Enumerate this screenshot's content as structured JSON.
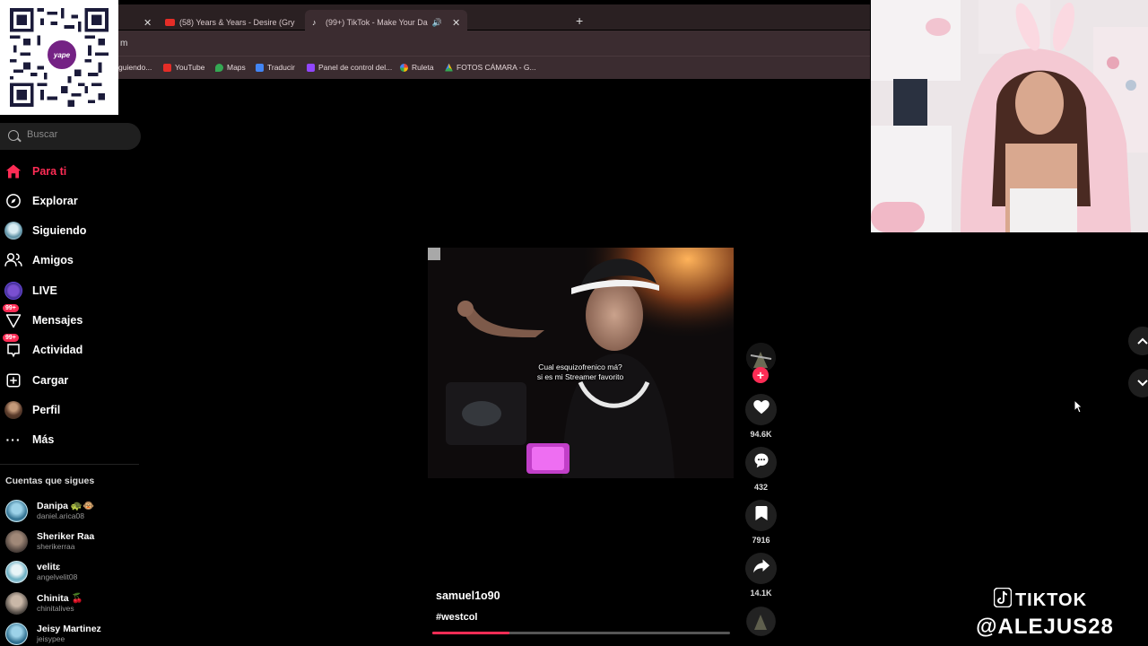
{
  "browser": {
    "tabs": [
      {
        "label": "(58) Years & Years - Desire (Gry",
        "icon": "youtube-icon"
      },
      {
        "label": "(99+) TikTok - Make Your Da",
        "icon": "tiktok-icon",
        "active": true
      }
    ],
    "address_fragment": "m",
    "bookmarks": [
      {
        "label": "guiendo..."
      },
      {
        "label": "YouTube",
        "color": "#e52d27"
      },
      {
        "label": "Maps",
        "color": "#34a853"
      },
      {
        "label": "Traducir",
        "color": "#4285f4"
      },
      {
        "label": "Panel de control del...",
        "color": "#9146ff"
      },
      {
        "label": "Ruleta",
        "color": "#ea4335"
      },
      {
        "label": "FOTOS CÁMARA - G...",
        "color": "#fbbc04"
      }
    ]
  },
  "qr": {
    "brand": "yape"
  },
  "sidebar": {
    "search_placeholder": "Buscar",
    "nav": [
      {
        "label": "Para ti",
        "icon": "home-icon",
        "active": true
      },
      {
        "label": "Explorar",
        "icon": "compass-icon"
      },
      {
        "label": "Siguiendo",
        "icon": "following-avatar-icon"
      },
      {
        "label": "Amigos",
        "icon": "friends-icon"
      },
      {
        "label": "LIVE",
        "icon": "live-icon"
      },
      {
        "label": "Mensajes",
        "icon": "messages-icon",
        "badge": "99+"
      },
      {
        "label": "Actividad",
        "icon": "activity-icon",
        "badge": "99+"
      },
      {
        "label": "Cargar",
        "icon": "upload-icon"
      },
      {
        "label": "Perfil",
        "icon": "profile-avatar-icon"
      },
      {
        "label": "Más",
        "icon": "more-icon"
      }
    ],
    "following_title": "Cuentas que sigues",
    "following": [
      {
        "name": "Danipa 🐢🐵",
        "handle": "daniel.arica08"
      },
      {
        "name": "Sheriker Raa",
        "handle": "sherikerraa"
      },
      {
        "name": "velitɛ",
        "handle": "angelvelit08"
      },
      {
        "name": "Chinita 🍒",
        "handle": "chinitalives"
      },
      {
        "name": "Jeisy Martinez",
        "handle": "jeisypee"
      }
    ]
  },
  "video": {
    "caption_line1": "Cual esquizofrenico má?",
    "caption_line2": "si es mi Streamer favorito",
    "author": "samuel1o90",
    "hashtag": "#westcol",
    "progress_fraction": 0.26
  },
  "actions": {
    "likes": "94.6K",
    "comments": "432",
    "saves": "7916",
    "shares": "14.1K"
  },
  "watermark": {
    "line1": "TIKTOK",
    "line2": "@ALEJUS28"
  },
  "colors": {
    "accent": "#fe2c55",
    "tab_bg": "#3b2c30"
  }
}
